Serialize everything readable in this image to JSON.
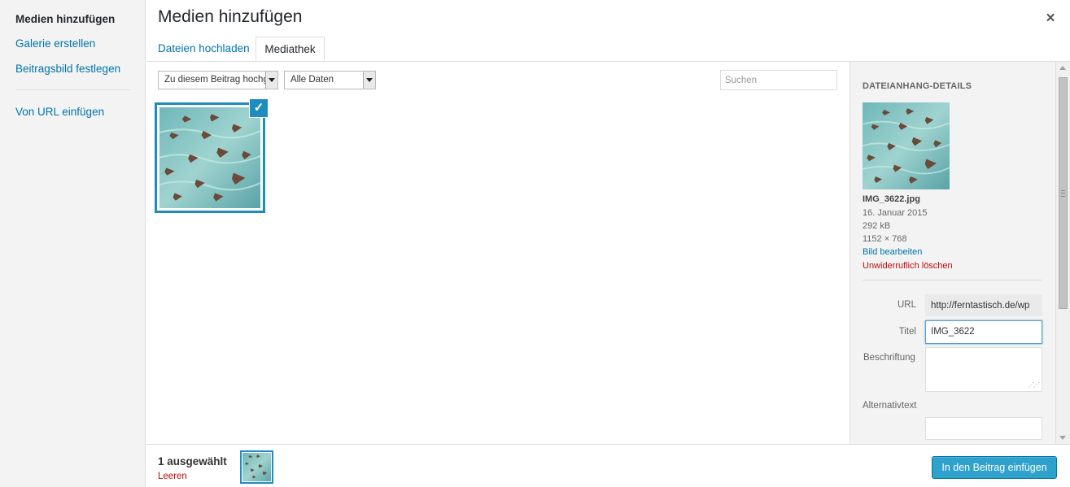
{
  "menu": {
    "items": [
      {
        "label": "Medien hinzufügen",
        "active": true
      },
      {
        "label": "Galerie erstellen",
        "active": false
      },
      {
        "label": "Beitragsbild festlegen",
        "active": false
      }
    ],
    "url_item": "Von URL einfügen"
  },
  "header": {
    "title": "Medien hinzufügen",
    "close_icon": "close-icon"
  },
  "tabs": [
    {
      "label": "Dateien hochladen",
      "active": false
    },
    {
      "label": "Mediathek",
      "active": true
    }
  ],
  "toolbar": {
    "filter_select": "Zu diesem Beitrag hochgeladen",
    "date_select": "Alle Daten",
    "search_placeholder": "Suchen"
  },
  "attachment": {
    "selected": true,
    "check_icon": "checkmark-icon"
  },
  "details": {
    "heading": "DATEIANHANG-DETAILS",
    "filename": "IMG_3622.jpg",
    "date": "16. Januar 2015",
    "filesize": "292 kB",
    "dimensions": "1152 × 768",
    "edit_link": "Bild bearbeiten",
    "delete_link": "Unwiderruflich löschen",
    "fields": {
      "url_label": "URL",
      "url_value": "http://ferntastisch.de/wp",
      "title_label": "Titel",
      "title_value": "IMG_3622",
      "caption_label": "Beschriftung",
      "caption_value": "",
      "alt_label": "Alternativtext",
      "alt_value": ""
    }
  },
  "bottom": {
    "selected_count": "1 ausgewählt",
    "clear_link": "Leeren",
    "insert_button": "In den Beitrag einfügen"
  },
  "colors": {
    "accent": "#1e8cbe",
    "link": "#0073aa",
    "danger": "#bc0b0b",
    "button": "#2ea2cc"
  }
}
